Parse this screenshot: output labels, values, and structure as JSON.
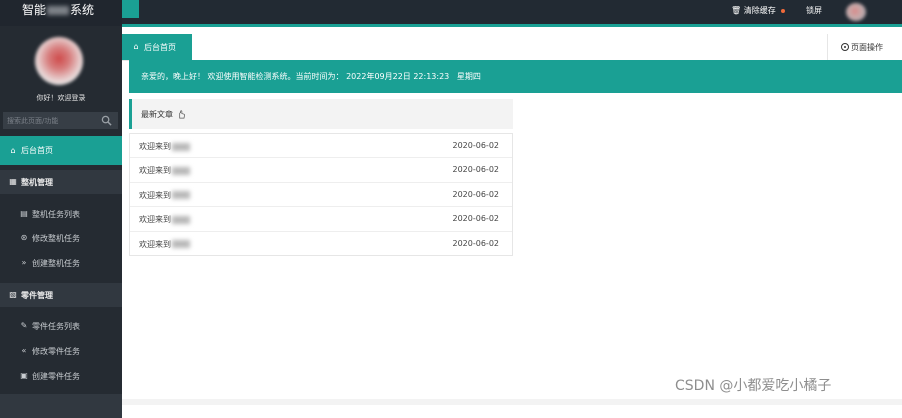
{
  "app": {
    "title_prefix": "智能",
    "title_suffix": "系统"
  },
  "topbar": {
    "clear_cache_icon": "trash-icon",
    "clear_cache_label": "清除缓存",
    "lock_label": "锁屏",
    "avatar_icon": "user-avatar"
  },
  "sidebar": {
    "greeting": "你好！欢迎登录",
    "search_placeholder": "搜索此页面/功能",
    "items": [
      {
        "type": "home",
        "icon": "home-icon",
        "label": "后台首页"
      },
      {
        "type": "group",
        "icon": "machine-icon",
        "label": "整机管理"
      },
      {
        "type": "sub",
        "icon": "list-icon",
        "label": "整机任务列表"
      },
      {
        "type": "sub",
        "icon": "cart-icon",
        "label": "修改整机任务"
      },
      {
        "type": "sub",
        "icon": "double-right-icon",
        "label": "创建整机任务"
      },
      {
        "type": "group",
        "icon": "parts-icon",
        "label": "零件管理"
      },
      {
        "type": "sub",
        "icon": "edit-list-icon",
        "label": "零件任务列表"
      },
      {
        "type": "sub",
        "icon": "double-left-icon",
        "label": "修改零件任务"
      },
      {
        "type": "sub",
        "icon": "car-icon",
        "label": "创建零件任务"
      }
    ]
  },
  "tabs": {
    "home_tab": "后台首页",
    "page_ops": "页面操作"
  },
  "welcome": {
    "text": "亲爱的，晚上好！ 欢迎使用智能检测系统。当前时间为： 2022年09月22日 22:13:23   星期四"
  },
  "articles": {
    "header": "最新文章",
    "rows": [
      {
        "title": "欢迎来到",
        "date": "2020-06-02"
      },
      {
        "title": "欢迎来到",
        "date": "2020-06-02"
      },
      {
        "title": "欢迎来到",
        "date": "2020-06-02"
      },
      {
        "title": "欢迎来到",
        "date": "2020-06-02"
      },
      {
        "title": "欢迎来到",
        "date": "2020-06-02"
      }
    ]
  },
  "watermark": "CSDN @小都爱吃小橘子",
  "colors": {
    "accent": "#1aa094",
    "sidebar_bg": "#252b32",
    "topbar_bg": "#222a33",
    "badge_dot": "#f06a3a"
  }
}
